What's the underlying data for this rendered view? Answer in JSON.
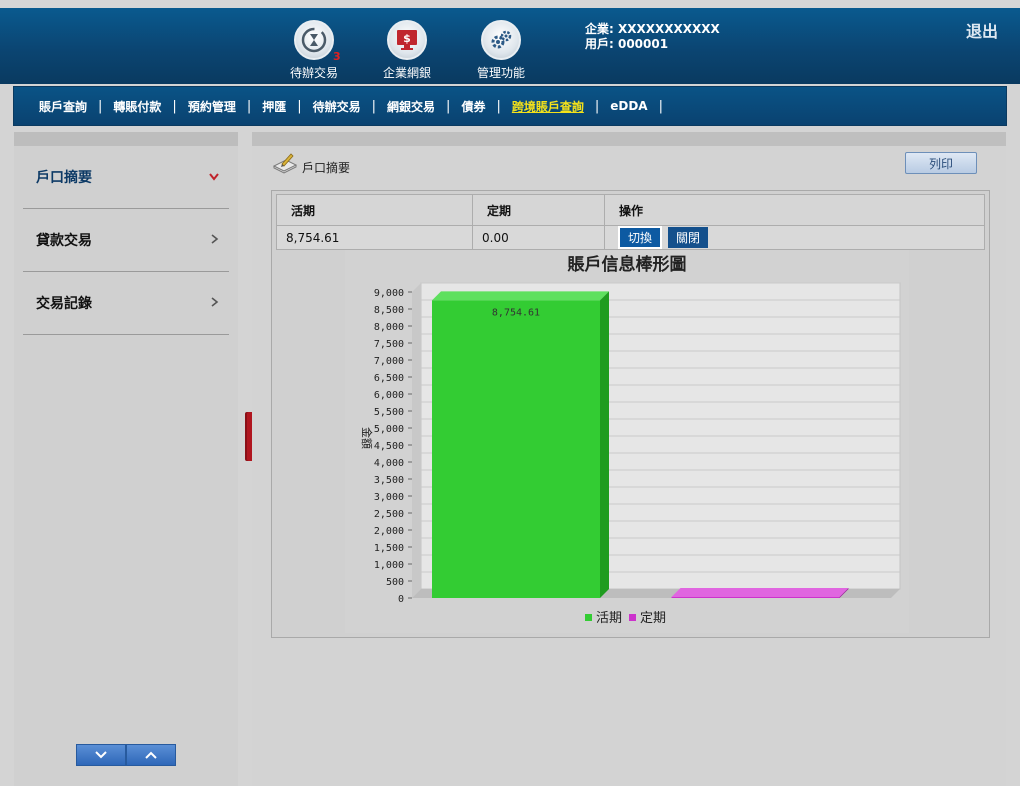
{
  "header": {
    "icons": [
      {
        "label": "待辦交易",
        "icon": "hourglass-icon",
        "badge": "3"
      },
      {
        "label": "企業網銀",
        "icon": "monitor-dollar-icon"
      },
      {
        "label": "管理功能",
        "icon": "gears-icon"
      }
    ],
    "company_line": "企業: XXXXXXXXXXX",
    "user_line": "用戶: 000001",
    "logout": "退出"
  },
  "nav": {
    "items": [
      "賬戶查詢",
      "轉賬付款",
      "預約管理",
      "押匯",
      "待辦交易",
      "網銀交易",
      "債券",
      "跨境賬戶查詢",
      "eDDA"
    ],
    "active_index": 7
  },
  "sidebar": {
    "items": [
      {
        "label": "戶口摘要",
        "chevron": "chevron-down-icon"
      },
      {
        "label": "貸款交易",
        "chevron": "chevron-right-icon"
      },
      {
        "label": "交易記錄",
        "chevron": "chevron-right-icon"
      }
    ]
  },
  "main": {
    "title": "戶口摘要",
    "print_label": "列印",
    "table": {
      "headers": [
        "活期",
        "定期",
        "操作"
      ],
      "row": [
        "8,754.61",
        "0.00"
      ],
      "switch_label": "切換",
      "close_label": "關閉"
    }
  },
  "chart_data": {
    "type": "bar",
    "title": "賬戶信息棒形圖",
    "ylabel": "金額",
    "ylim": [
      0,
      9000
    ],
    "ytick_step": 500,
    "series": [
      {
        "name": "活期",
        "values": [
          8754.61
        ],
        "color": "#33cc33"
      },
      {
        "name": "定期",
        "values": [
          0
        ],
        "color": "#cc33cc"
      }
    ],
    "data_labels": [
      "8,754.61"
    ],
    "grid": true,
    "legend_position": "bottom"
  }
}
